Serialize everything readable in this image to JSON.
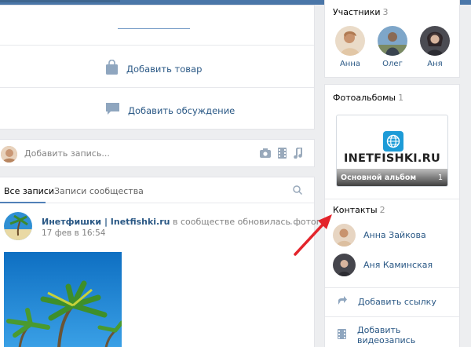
{
  "group": {
    "actions": {
      "add_product": "Добавить товар",
      "add_discussion": "Добавить обсуждение"
    },
    "composer": {
      "placeholder": "Добавить запись..."
    },
    "feed": {
      "tabs": [
        "Все записи",
        "Записи сообщества"
      ],
      "active_tab": 0,
      "post": {
        "author": "Инетфишки | Inetfishki.ru",
        "action": " в сообществе обновилась фотография",
        "date": "17 фев в 16:54",
        "more": "···"
      }
    }
  },
  "sidebar": {
    "members": {
      "title": "Участники",
      "count": "3",
      "people": [
        "Анна",
        "Олег",
        "Аня"
      ]
    },
    "albums": {
      "title": "Фотоальбомы",
      "count": "1",
      "album": {
        "brand": "INETFISHKI.RU",
        "name": "Основной альбом",
        "photos": "1"
      }
    },
    "contacts": {
      "title": "Контакты",
      "count": "2",
      "people": [
        "Анна Зайкова",
        "Аня Каминская"
      ]
    },
    "links": {
      "add_link": "Добавить ссылку",
      "add_video": "Добавить видеозапись"
    }
  },
  "colors": {
    "link": "#2a5885",
    "accent": "#5181b8",
    "header": "#4a76a8",
    "background": "#edeef0",
    "annotation_arrow": "#e3242b"
  }
}
